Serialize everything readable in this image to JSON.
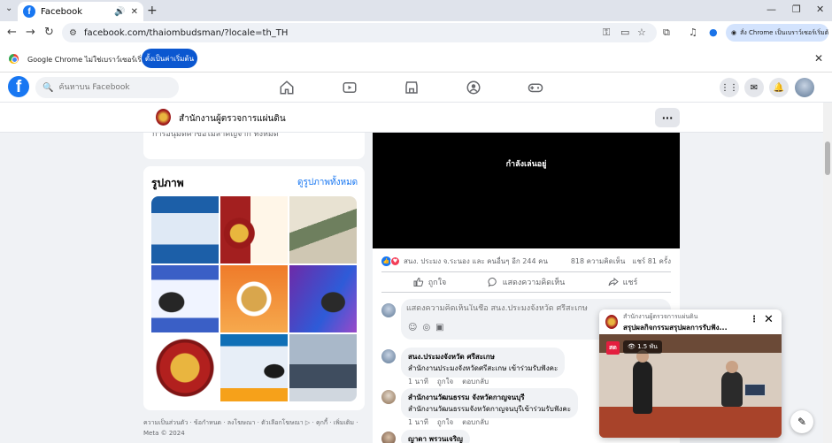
{
  "browser": {
    "tab_title": "Facebook",
    "url": "facebook.com/thaiombudsman/?locale=th_TH",
    "profile_label": "สั่ง Chrome เป็นเบราว์เซอร์เริ่มต้น",
    "infobar_text": "Google Chrome ไม่ใช่เบราว์เซอร์เริ่มต้น",
    "infobar_button": "ตั้งเป็นค่าเริ่มต้น"
  },
  "fb": {
    "search_placeholder": "ค้นหาบน Facebook",
    "page_name": "สำนักงานผู้ตรวจการแผ่นดิน"
  },
  "left": {
    "cut_text": "การอนุมัติคำขอไม่สำคัญจาก ทั้งหมด",
    "photos_title": "รูปภาพ",
    "photos_all": "ดูรูปภาพทั้งหมด",
    "footer": "ความเป็นส่วนตัว · ข้อกำหนด · ลงโฆษณา · ตัวเลือกโฆษณา ▷ · คุกกี้ · เพิ่มเติม · Meta © 2024"
  },
  "post": {
    "video_status": "กำลังเล่นอยู่",
    "reactions_text": "สนง. ประมง จ.ระนอง และ คนอื่นๆ อีก 244 คน",
    "comments_count": "818 ความคิดเห็น",
    "shares_count": "แชร์ 81 ครั้ง",
    "like_label": "ถูกใจ",
    "comment_label": "แสดงความคิดเห็น",
    "share_label": "แชร์",
    "comment_placeholder": "แสดงความคิดเห็นในชื่อ สนง.ประมงจังหวัด ศรีสะเกษ",
    "comments": [
      {
        "name": "สนง.ประมงจังหวัด ศรีสะเกษ",
        "text": "สำนักงานประมงจังหวัดศรีสะเกษ เข้าร่วมรับฟังคะ",
        "time": "1 นาที",
        "like": "ถูกใจ",
        "reply": "ตอบกลับ"
      },
      {
        "name": "สำนักงานวัฒนธรรม จังหวัดกาญจนบุรี",
        "text": "สำนักงานวัฒนธรรมจังหวัดกาญจนบุรีเข้าร่วมรับฟังคะ",
        "time": "1 นาที",
        "like": "ถูกใจ",
        "reply": "ตอบกลับ"
      },
      {
        "name": "ญาดา พรวนเจริญ"
      }
    ]
  },
  "mini_player": {
    "source": "สำนักงานผู้ตรวจการแผ่นดิน",
    "title": "สรุปผลกิจกรรมสรุปผลการรับฟัง...",
    "live_label": "สด",
    "viewers": "1.5 พัน"
  }
}
